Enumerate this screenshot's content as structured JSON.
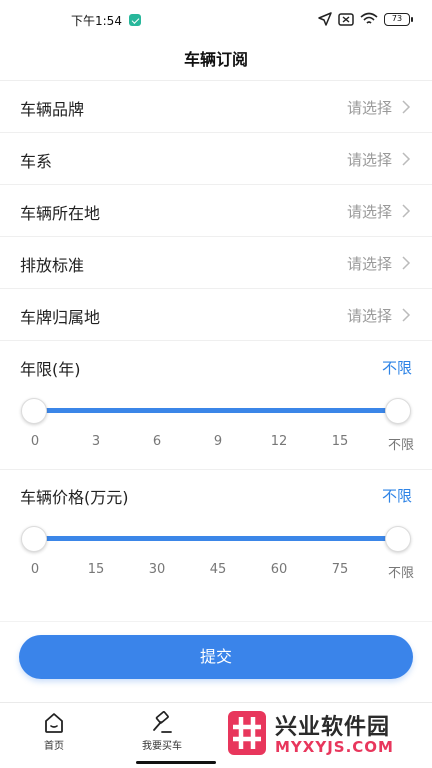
{
  "status_bar": {
    "time": "下午1:54",
    "battery": "73"
  },
  "header": {
    "title": "车辆订阅"
  },
  "select_rows": [
    {
      "label": "车辆品牌",
      "value": "请选择"
    },
    {
      "label": "车系",
      "value": "请选择"
    },
    {
      "label": "车辆所在地",
      "value": "请选择"
    },
    {
      "label": "排放标准",
      "value": "请选择"
    },
    {
      "label": "车牌归属地",
      "value": "请选择"
    }
  ],
  "year_range": {
    "title": "年限(年)",
    "value": "不限",
    "ticks": [
      "0",
      "3",
      "6",
      "9",
      "12",
      "15",
      "不限"
    ],
    "selected_min": "0",
    "selected_max": "不限"
  },
  "price_range": {
    "title": "车辆价格(万元)",
    "value": "不限",
    "ticks": [
      "0",
      "15",
      "30",
      "45",
      "60",
      "75",
      "不限"
    ],
    "selected_min": "0",
    "selected_max": "不限"
  },
  "submit": {
    "label": "提交"
  },
  "tabbar": {
    "items": [
      {
        "label": "首页",
        "icon": "home-icon"
      },
      {
        "label": "我要买车",
        "icon": "hammer-icon"
      }
    ]
  },
  "watermark": {
    "name": "兴业软件园",
    "site": "MYXYJS.COM"
  },
  "colors": {
    "accent": "#3a84ea",
    "link": "#2f84e6",
    "placeholder": "#9a9a9a",
    "watermark_red": "#e8365c"
  }
}
